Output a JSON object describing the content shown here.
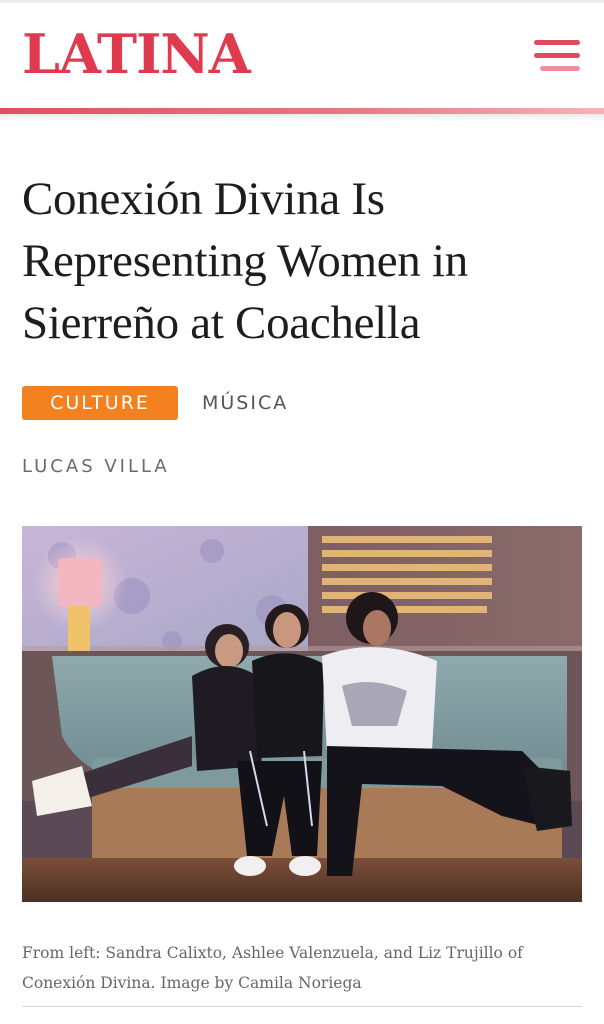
{
  "header": {
    "logo_text": "LATINA",
    "menu_icon": "hamburger-menu-icon"
  },
  "article": {
    "title": "Conexión Divina Is Representing Women in Sierreño at Coachella",
    "tags": [
      {
        "label": "CULTURE",
        "color": "#f48120"
      },
      {
        "label": "MÚSICA"
      }
    ],
    "author": "LUCAS VILLA",
    "image": {
      "caption": "From left: Sandra Calixto, Ashlee Valenzuela, and Liz Trujillo of Conexión Divina. Image by Camila Noriega"
    }
  },
  "colors": {
    "brand": "#e03a4f",
    "accent_orange": "#f48120"
  }
}
